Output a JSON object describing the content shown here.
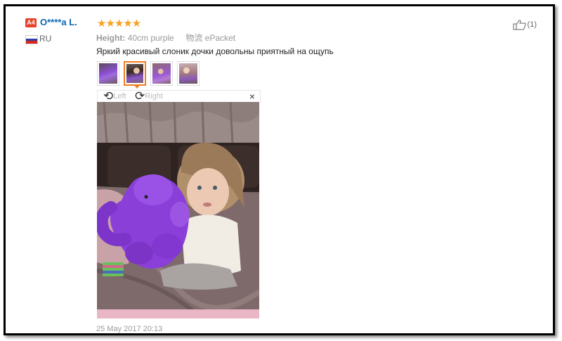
{
  "review": {
    "badge": "A4",
    "user_name": "O****a L.",
    "country": "RU",
    "rating": "★★★★★",
    "attr_label": "Height:",
    "attr_value": "40cm purple",
    "shipping_label": "物流",
    "shipping_value": "ePacket",
    "comment": "Яркий красивый слоник дочки довольны приятный на ощупь",
    "date": "25 May 2017 20:13",
    "likes": "(1)"
  },
  "viewer": {
    "left_label": "Left",
    "right_label": "Right",
    "close": "×"
  },
  "colors": {
    "name": "#0a64b4",
    "star": "#f7a221",
    "badge": "#e64329",
    "active_thumb": "#f27e1b"
  }
}
